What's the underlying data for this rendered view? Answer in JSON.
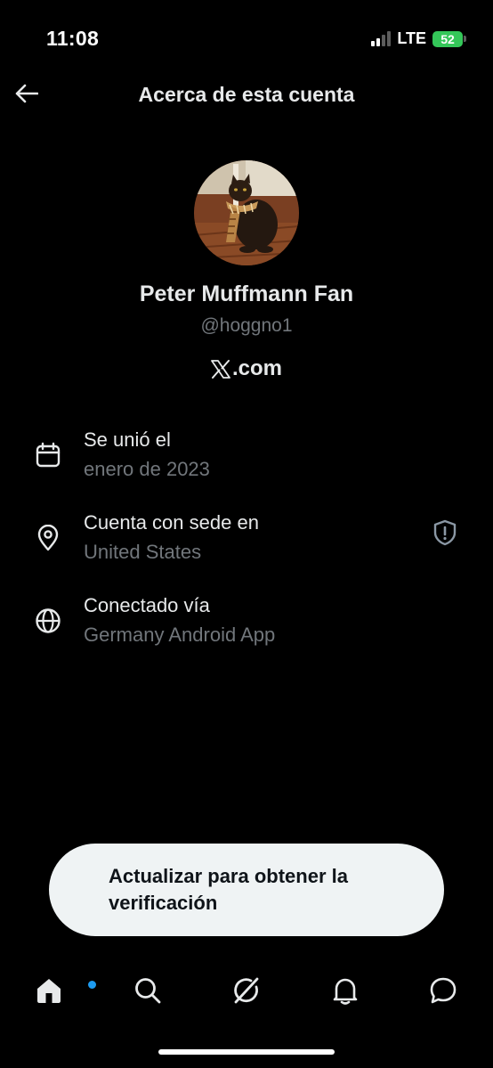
{
  "status_bar": {
    "time": "11:08",
    "network": "LTE",
    "battery": "52"
  },
  "header": {
    "title": "Acerca de esta cuenta",
    "back_icon": "arrow-left-icon"
  },
  "profile": {
    "name": "Peter Muffmann Fan",
    "handle": "@hoggno1",
    "platform_logo": "x-logo-icon",
    "platform_domain": ".com"
  },
  "info_rows": [
    {
      "icon": "calendar-icon",
      "label": "Se unió el",
      "value": "enero de 2023"
    },
    {
      "icon": "location-pin-icon",
      "label": "Cuenta con sede en",
      "value": "United States"
    },
    {
      "icon": "globe-icon",
      "label": "Conectado vía",
      "value": "Germany Android App"
    }
  ],
  "upgrade_banner": {
    "text": "Actualizar para obtener la verificación"
  },
  "bottom_nav": {
    "items": [
      "home-icon",
      "search-icon",
      "grok-icon",
      "notifications-bell-icon",
      "messages-icon"
    ],
    "active": "home-icon",
    "home_has_new_dot": true
  },
  "colors": {
    "background": "#000000",
    "primary_text": "#e7e9ea",
    "secondary_text": "#71767b",
    "accent": "#1d9bf0",
    "banner_bg": "#eff3f4",
    "battery": "#34c759"
  }
}
